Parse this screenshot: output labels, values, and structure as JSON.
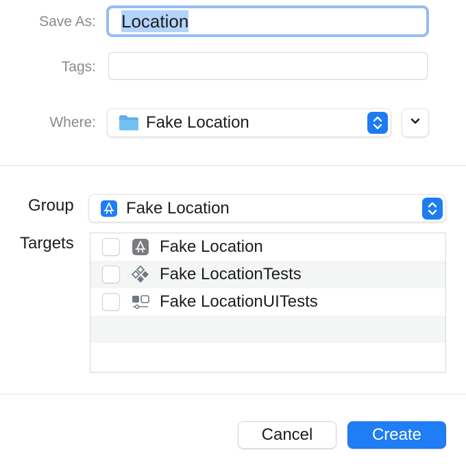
{
  "save_as": {
    "label": "Save As:",
    "value": "Location"
  },
  "tags": {
    "label": "Tags:",
    "value": ""
  },
  "where": {
    "label": "Where:",
    "selected": "Fake Location",
    "icon": "folder-icon"
  },
  "group": {
    "label": "Group",
    "selected": "Fake Location",
    "icon": "app-store-icon"
  },
  "targets": {
    "label": "Targets",
    "items": [
      {
        "label": "Fake Location",
        "checked": false,
        "icon": "app-target-icon"
      },
      {
        "label": "Fake LocationTests",
        "checked": false,
        "icon": "unit-test-target-icon"
      },
      {
        "label": "Fake LocationUITests",
        "checked": false,
        "icon": "ui-test-target-icon"
      }
    ]
  },
  "buttons": {
    "cancel": "Cancel",
    "create": "Create"
  },
  "colors": {
    "accent": "#1f7df5",
    "focus_ring": "#94bdf0",
    "selection": "#b3d3f8"
  }
}
